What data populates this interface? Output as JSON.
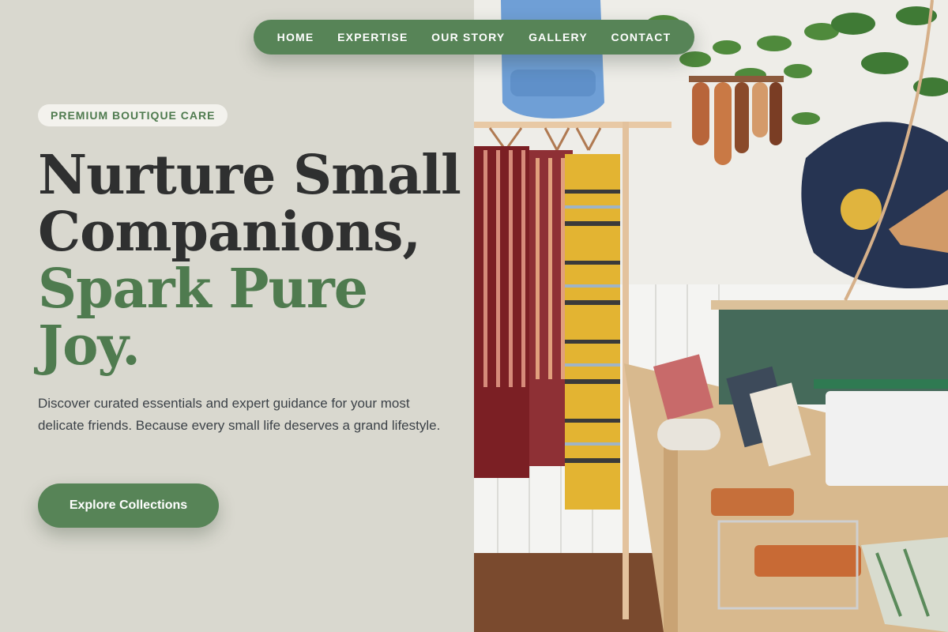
{
  "nav": {
    "items": [
      {
        "label": "HOME"
      },
      {
        "label": "EXPERTISE"
      },
      {
        "label": "OUR STORY"
      },
      {
        "label": "GALLERY"
      },
      {
        "label": "CONTACT"
      }
    ]
  },
  "hero": {
    "badge": "PREMIUM BOUTIQUE CARE",
    "headline_line1": "Nurture Small",
    "headline_line2": "Companions,",
    "headline_accent_line1": "Spark Pure",
    "headline_accent_line2": "Joy.",
    "description": "Discover curated essentials and expert guidance for your most delicate friends. Because every small life deserves a grand lifestyle.",
    "cta_label": "Explore Collections"
  },
  "colors": {
    "brand_green": "#578457",
    "accent_text_green": "#4f7b4f",
    "background": "#d9d8cf",
    "heading_dark": "#2f3030"
  }
}
